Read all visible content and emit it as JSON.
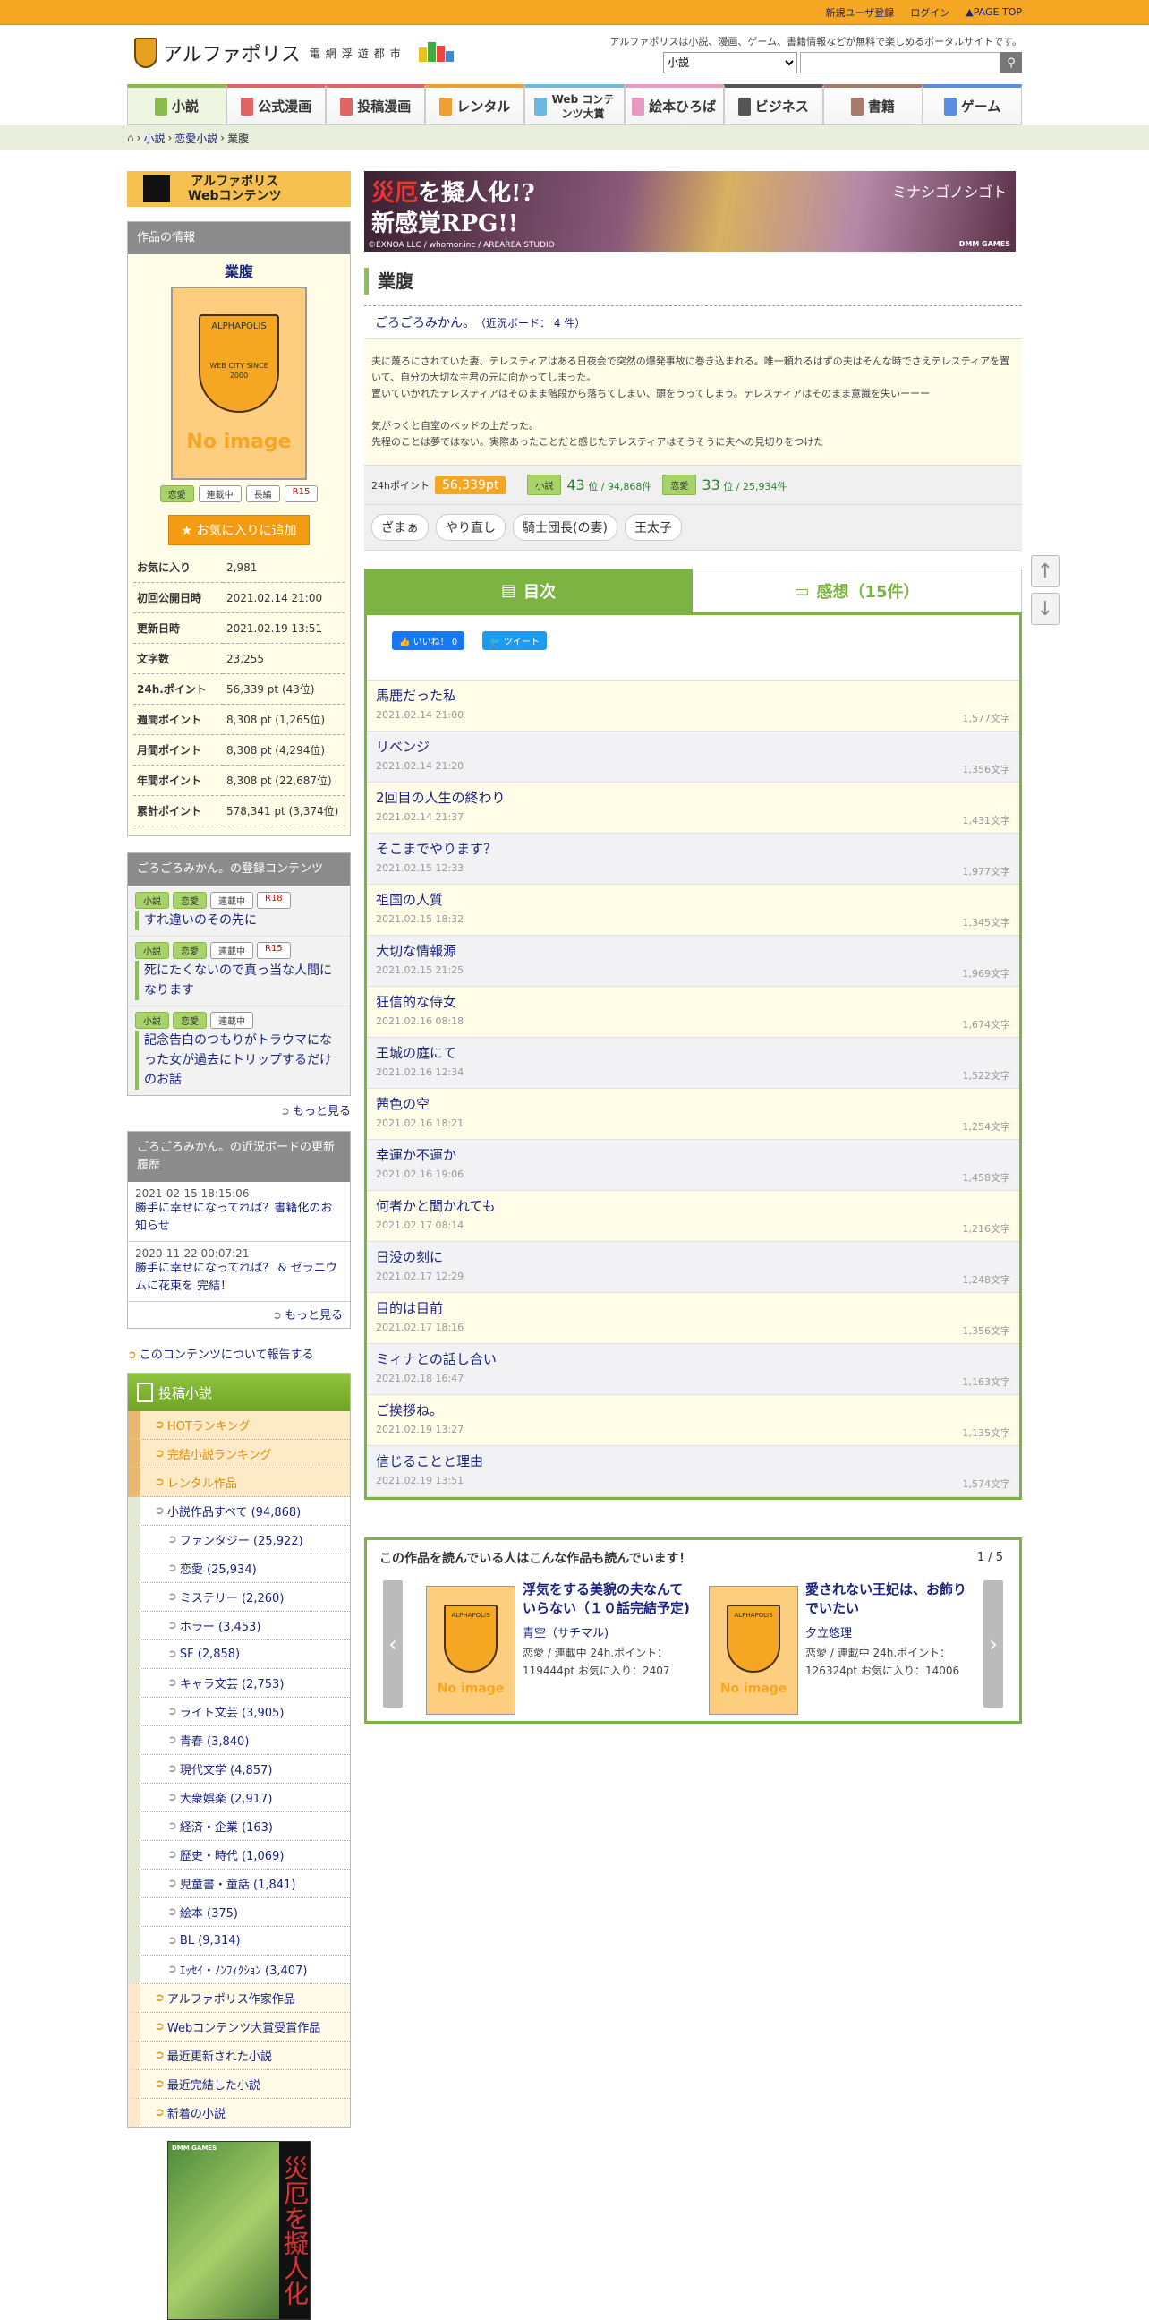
{
  "topbar": {
    "register": "新規ユーザ登録",
    "login": "ログイン",
    "pagetop": "▲PAGE TOP"
  },
  "header": {
    "logo_text": "アルファポリス",
    "logo_sub": "電網浮遊都市",
    "tagline": "アルファポリスは小説、漫画、ゲーム、書籍情報などが無料で楽しめるポータルサイトです。",
    "search_select": "小説",
    "search_placeholder": "",
    "search_icon": "search-icon"
  },
  "nav": [
    {
      "label": "小説",
      "color": "#8cba51"
    },
    {
      "label": "公式漫画",
      "color": "#e06666"
    },
    {
      "label": "投稿漫画",
      "color": "#e06666"
    },
    {
      "label": "レンタル",
      "color": "#f0a030"
    },
    {
      "label": "Web コンテンツ大賞",
      "color": "#6cb8e0"
    },
    {
      "label": "絵本ひろば",
      "color": "#e89ac0"
    },
    {
      "label": "ビジネス",
      "color": "#555555"
    },
    {
      "label": "書籍",
      "color": "#a87a6a"
    },
    {
      "label": "ゲーム",
      "color": "#5a8ee0"
    }
  ],
  "breadcrumb": {
    "items": [
      "小説",
      "恋愛小説"
    ],
    "current": "業腹"
  },
  "sidebar": {
    "web_banner": {
      "line1": "アルファポリス",
      "line2": "Webコンテンツ"
    },
    "info": {
      "header": "作品の情報",
      "title": "業腹",
      "cover_logo": "ALPHAPOLIS",
      "cover_sub": "WEB CITY SINCE 2000",
      "no_image": "No image",
      "tags": [
        "恋愛",
        "連載中",
        "長編",
        "R15"
      ],
      "fav_button": "★ お気に入りに追加",
      "stats": [
        [
          "お気に入り",
          "2,981"
        ],
        [
          "初回公開日時",
          "2021.02.14 21:00"
        ],
        [
          "更新日時",
          "2021.02.19 13:51"
        ],
        [
          "文字数",
          "23,255"
        ],
        [
          "24h.ポイント",
          "56,339 pt (43位)"
        ],
        [
          "週間ポイント",
          "8,308 pt (1,265位)"
        ],
        [
          "月間ポイント",
          "8,308 pt (4,294位)"
        ],
        [
          "年間ポイント",
          "8,308 pt (22,687位)"
        ],
        [
          "累計ポイント",
          "578,341 pt (3,374位)"
        ]
      ]
    },
    "registered": {
      "header": "ごろごろみかん。の登録コンテンツ",
      "items": [
        {
          "tags": [
            "小説",
            "恋愛",
            "連載中",
            "R18"
          ],
          "title": "すれ違いのその先に"
        },
        {
          "tags": [
            "小説",
            "恋愛",
            "連載中",
            "R15"
          ],
          "title": "死にたくないので真っ当な人間になります"
        },
        {
          "tags": [
            "小説",
            "恋愛",
            "連載中"
          ],
          "title": "記念告白のつもりがトラウマになった女が過去にトリップするだけのお話"
        }
      ],
      "more": "もっと見る"
    },
    "board": {
      "header": "ごろごろみかん。の近況ボードの更新履歴",
      "items": [
        {
          "date": "2021-02-15 18:15:06",
          "title": "勝手に幸せになってれば？書籍化のお知らせ"
        },
        {
          "date": "2020-11-22 00:07:21",
          "title": "勝手に幸せになってれば？ & ゼラニウムに花束を 完結！"
        }
      ],
      "more": "もっと見る"
    },
    "report": "このコンテンツについて報告する",
    "category": {
      "header": "投稿小説",
      "items": [
        {
          "label": "HOTランキング",
          "type": "hot"
        },
        {
          "label": "完結小説ランキング",
          "type": "hot"
        },
        {
          "label": "レンタル作品",
          "type": "hot"
        },
        {
          "label": "小説作品すべて (94,868)",
          "type": "gen"
        },
        {
          "label": "ファンタジー (25,922)",
          "type": "gen sub"
        },
        {
          "label": "恋愛 (25,934)",
          "type": "gen sub"
        },
        {
          "label": "ミステリー (2,260)",
          "type": "gen sub"
        },
        {
          "label": "ホラー (3,453)",
          "type": "gen sub"
        },
        {
          "label": "SF (2,858)",
          "type": "gen sub"
        },
        {
          "label": "キャラ文芸 (2,753)",
          "type": "gen sub"
        },
        {
          "label": "ライト文芸 (3,905)",
          "type": "gen sub"
        },
        {
          "label": "青春 (3,840)",
          "type": "gen sub"
        },
        {
          "label": "現代文学 (4,857)",
          "type": "gen sub"
        },
        {
          "label": "大衆娯楽 (2,917)",
          "type": "gen sub"
        },
        {
          "label": "経済・企業 (163)",
          "type": "gen sub"
        },
        {
          "label": "歴史・時代 (1,069)",
          "type": "gen sub"
        },
        {
          "label": "児童書・童話 (1,841)",
          "type": "gen sub"
        },
        {
          "label": "絵本 (375)",
          "type": "gen sub"
        },
        {
          "label": "BL (9,314)",
          "type": "gen sub"
        },
        {
          "label": "ｴｯｾｲ・ﾉﾝﾌｨｸｼｮﾝ (3,407)",
          "type": "gen sub"
        },
        {
          "label": "アルファポリス作家作品",
          "type": "ora"
        },
        {
          "label": "Webコンテンツ大賞受賞作品",
          "type": "ora"
        },
        {
          "label": "最近更新された小説",
          "type": "ora"
        },
        {
          "label": "最近完結した小説",
          "type": "ora"
        },
        {
          "label": "新着の小説",
          "type": "ora"
        }
      ]
    },
    "ad": {
      "brand": "DMM GAMES",
      "text": "災厄を擬人化"
    }
  },
  "main": {
    "ad": {
      "line1a": "災厄",
      "line1b": "を擬人化!?",
      "line2": "新感覚RPG!!",
      "copyright": "©EXNOA LLC / whomor.inc / AREAREA STUDIO",
      "game": "ミナシゴノシゴト",
      "brand": "DMM GAMES"
    },
    "title": "業腹",
    "author": "ごろごろみかん。",
    "board_count": "（近況ボード： 4 件）",
    "description": "夫に蔑ろにされていた妻、テレスティアはある日夜会で突然の爆発事故に巻き込まれる。唯一頼れるはずの夫はそんな時でさえテレスティアを置いて、自分の大切な主君の元に向かってしまった。\n置いていかれたテレスティアはそのまま階段から落ちてしまい、頭をうってしまう。テレスティアはそのまま意識を失いーーー\n\n気がつくと自室のベッドの上だった。\n先程のことは夢ではない。実際あったことだと感じたテレスティアはそうそうに夫への見切りをつけた",
    "points": {
      "label": "24hポイント",
      "value": "56,339pt",
      "rank1_tag": "小説",
      "rank1": "43",
      "rank1_total": "位 / 94,868件",
      "rank2_tag": "恋愛",
      "rank2": "33",
      "rank2_total": "位 / 25,934件"
    },
    "chips": [
      "ざまぁ",
      "やり直し",
      "騎士団長(の妻)",
      "王太子"
    ],
    "tabs": {
      "toc": "目次",
      "comments": "感想（15件）"
    },
    "social": {
      "like": "いいね！ 0",
      "tweet": "ツイート"
    },
    "episodes": [
      {
        "title": "馬鹿だった私",
        "date": "2021.02.14 21:00",
        "chars": "1,577文字"
      },
      {
        "title": "リベンジ",
        "date": "2021.02.14 21:20",
        "chars": "1,356文字"
      },
      {
        "title": "2回目の人生の終わり",
        "date": "2021.02.14 21:37",
        "chars": "1,431文字"
      },
      {
        "title": "そこまでやります？",
        "date": "2021.02.15 12:33",
        "chars": "1,977文字"
      },
      {
        "title": "祖国の人質",
        "date": "2021.02.15 18:32",
        "chars": "1,345文字"
      },
      {
        "title": "大切な情報源",
        "date": "2021.02.15 21:25",
        "chars": "1,969文字"
      },
      {
        "title": "狂信的な侍女",
        "date": "2021.02.16 08:18",
        "chars": "1,674文字"
      },
      {
        "title": "王城の庭にて",
        "date": "2021.02.16 12:34",
        "chars": "1,522文字"
      },
      {
        "title": "茜色の空",
        "date": "2021.02.16 18:21",
        "chars": "1,254文字"
      },
      {
        "title": "幸運か不運か",
        "date": "2021.02.16 19:06",
        "chars": "1,458文字"
      },
      {
        "title": "何者かと聞かれても",
        "date": "2021.02.17 08:14",
        "chars": "1,216文字"
      },
      {
        "title": "日没の刻に",
        "date": "2021.02.17 12:29",
        "chars": "1,248文字"
      },
      {
        "title": "目的は目前",
        "date": "2021.02.17 18:16",
        "chars": "1,356文字"
      },
      {
        "title": "ミィナとの話し合い",
        "date": "2021.02.18 16:47",
        "chars": "1,163文字"
      },
      {
        "title": "ご挨拶ね。",
        "date": "2021.02.19 13:27",
        "chars": "1,135文字"
      },
      {
        "title": "信じることと理由",
        "date": "2021.02.19 13:51",
        "chars": "1,574文字"
      }
    ],
    "recommend": {
      "header": "この作品を読んでいる人はこんな作品も読んでいます！",
      "page": "1 / 5",
      "prev": "‹",
      "next": "›",
      "items": [
        {
          "title": "浮気をする美貌の夫なんていらない（１０話完結予定)",
          "author": "青空（サチマル)",
          "meta": "恋愛 / 連載中 24h.ポイント：119444pt お気に入り：2407"
        },
        {
          "title": "愛されない王妃は、お飾りでいたい",
          "author": "夕立悠理",
          "meta": "恋愛 / 連載中 24h.ポイント：126324pt お気に入り：14006"
        }
      ]
    }
  },
  "scroll": {
    "up": "↑",
    "down": "↓"
  }
}
